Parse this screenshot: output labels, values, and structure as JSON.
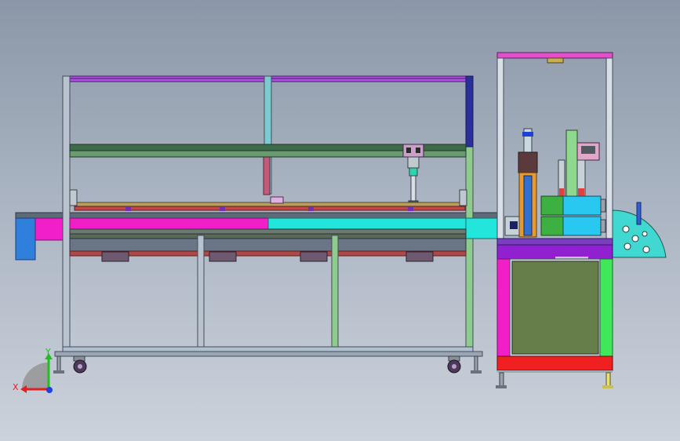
{
  "colors": {
    "background_top": "#8b97a8",
    "background_bottom": "#ccd2db",
    "frame_outline": "#3a3f48",
    "beam_magenta": "#f020c8",
    "beam_cyan": "#20e8e0",
    "beam_purple": "#8040e0",
    "beam_green": "#4a9a58",
    "cabinet_green": "#667f4a",
    "cabinet_base_red": "#f02020",
    "cabinet_top_purple": "#9020d0",
    "motor_green": "#3cb040",
    "motor_cyan": "#28c8f0",
    "end_block_blue": "#3080e0",
    "disc_cyan": "#40d8d0",
    "axis_x": "#e02020",
    "axis_y": "#20c020",
    "axis_z": "#2040e0"
  },
  "axis_triad": {
    "x_label": "X",
    "y_label": "Y"
  },
  "icons": {
    "triad": "coordinate-triad-icon",
    "caster": "caster-wheel-icon"
  }
}
